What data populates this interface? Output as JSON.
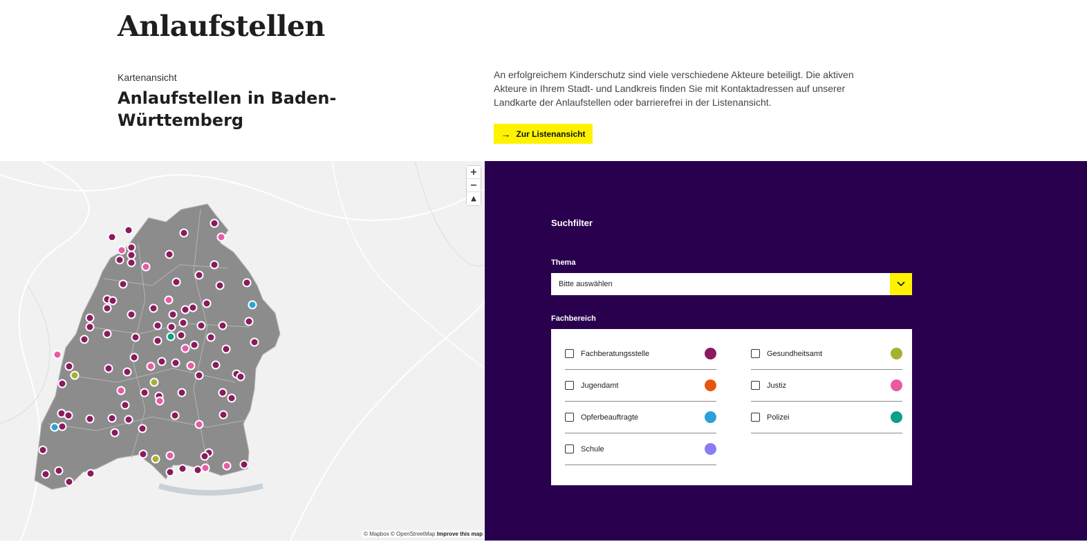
{
  "header": {
    "page_title": "Anlaufstellen",
    "kicker": "Kartenansicht",
    "subtitle": "Anlaufstellen in Baden-Württemberg",
    "intro": "An erfolgreichem Kinderschutz sind viele verschiedene Akteure beteiligt. Die aktiven Akteure in Ihrem Stadt- und Landkreis finden Sie mit Kontaktadressen auf unserer Landkarte der Anlaufstellen oder barrierefrei in der Listenansicht.",
    "list_button_label": "Zur Listenansicht"
  },
  "map": {
    "zoom_in_label": "+",
    "zoom_out_label": "−",
    "compass_label": "▲",
    "attribution": "© Mapbox © OpenStreetMap",
    "improve_link": "Improve this map",
    "marker_colors": {
      "fachberatungsstelle": "#8b1a5e",
      "gesundheitsamt": "#a5b12f",
      "jugendamt": "#e8550f",
      "justiz": "#e85aa4",
      "opferbeauftragte": "#2aa2d9",
      "polizei": "#0aa08a",
      "schule": "#8a7cf5"
    }
  },
  "filter": {
    "heading": "Suchfilter",
    "thema_label": "Thema",
    "thema_placeholder": "Bitte auswählen",
    "fachbereich_label": "Fachbereich",
    "options": [
      {
        "label": "Fachberatungsstelle",
        "color": "#8b1a5e"
      },
      {
        "label": "Gesundheitsamt",
        "color": "#a5b12f"
      },
      {
        "label": "Jugendamt",
        "color": "#e8550f"
      },
      {
        "label": "Justiz",
        "color": "#e85aa4"
      },
      {
        "label": "Opferbeauftragte",
        "color": "#2aa2d9"
      },
      {
        "label": "Polizei",
        "color": "#0aa08a"
      },
      {
        "label": "Schule",
        "color": "#8a7cf5"
      }
    ]
  },
  "colors": {
    "accent_yellow": "#fff200",
    "panel_purple": "#29004e",
    "region_gray": "#8c8c8c"
  }
}
